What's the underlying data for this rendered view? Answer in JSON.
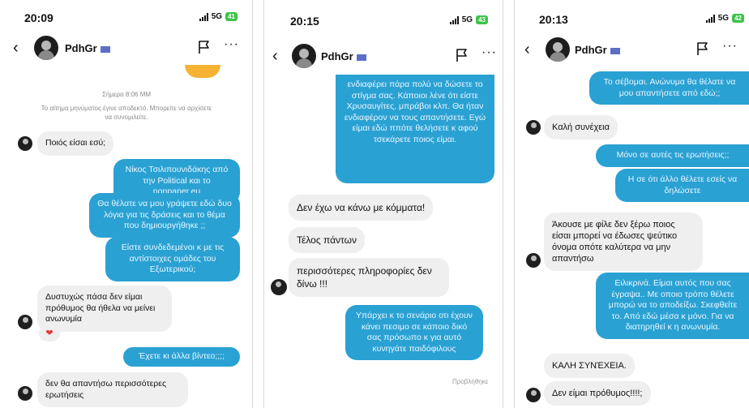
{
  "phones": [
    {
      "time": "20:09",
      "signal": "5G",
      "battery": "41",
      "contact": "PdhGr",
      "date_label": "Σήμερα 8:06 ΜΜ",
      "notice": "Το αίτημα μηνύματος έγινε αποδεκτό. Μπορείτε να αρχίσετε να συνομιλείτε.",
      "messages": [
        "Ποιός είσαι εσύ;",
        "Νίκος Τσιλιπουνιδάκης από την Political και το nonpaper.eu",
        "Θα θέλατε να μου γράψετε εδώ δυο λόγια για τις δράσεις και το θέμα που δημιουργήθηκε ;;",
        "Είστε συνδεδεμένοι κ με τις αντίστοιχες ομάδες του Εξωτερικού;",
        "Δυστυχώς πάσα δεν είμαι πρόθυμος θα ήθελα να μείνει ανωνυμία",
        "Έχετε κι άλλα βίντεο;;;;",
        "δεν θα απαντήσω περισσότερες ερωτήσεις"
      ]
    },
    {
      "time": "20:15",
      "signal": "5G",
      "battery": "43",
      "contact": "PdhGr",
      "messages": [
        "ενδιαφέρει πάρα πολύ να δώσετε το στίγμα σας. Κάποιοι λένε ότι είστε Χρυσαυγίτες, μπράβοι κλπ. Θα ήταν ενδιαφέρον να τους απαντήσετε. Εγώ είμαι εδώ ππότε θελήσετε κ αφού τσεκάρετε ποιος είμαι.",
        "Δεν έχω να κάνω με κόμματα!",
        "Τέλος πάντων",
        "περισσότερες πληροφορίες δεν δίνω !!!",
        "Υπάρχει κ το σενάριο οτι έχουν κάνει πεσιμο σε κάποιο δικό σας πρόσωπο κ για αυτό κυνηγάτε παιδόφιλους",
        "Προβλήθηκε"
      ]
    },
    {
      "time": "20:13",
      "signal": "5G",
      "battery": "42",
      "contact": "PdhGr",
      "messages": [
        "Το σέβομαι. Ανώνυμα θα θέλατε να μου απαντήσετε από εδώ;;",
        "Καλή συνέχεια",
        "Μόνο σε αυτές τις ερωτήσεις;;",
        "Η σε ότι άλλο θέλετε εσείς να δηλώσετε",
        "Άκουσε με φίλε δεν ξέρω ποιος είσαι μπορεί να έδωσες ψεύτικο όνομα οπότε καλύτερα να μην απαντήσω",
        "Ειλικρινά. Είμαι αυτός που σας έγραψα.. Με οποιο τρόπο θέλετε μπορώ να το αποδείξω. Σκεφθείτε το. Από εδώ μέσα κ μόνο. Για να διατηρηθεί κ η ανωνυμία.",
        "ΚΑΛΗ ΣΥΝΈΧΕΙΑ.",
        "Δεν είμαι πρόθυμος!!!!;"
      ]
    }
  ],
  "icons": {
    "back": "chevron-left-icon",
    "report": "flag-outline-icon",
    "more": "more-icon",
    "heart": "heart-icon"
  },
  "colors": {
    "outgoing": "#2aa1d3",
    "incoming": "#efefef",
    "heart": "#e53935",
    "battery": "#3ec34a"
  }
}
